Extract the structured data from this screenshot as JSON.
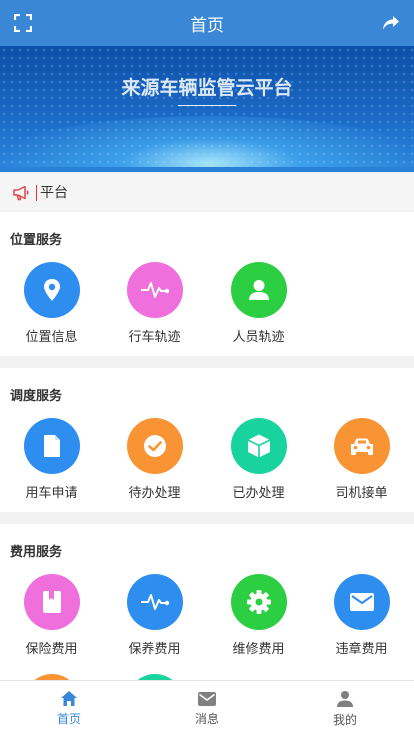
{
  "header": {
    "title": "首页"
  },
  "banner": {
    "title": "来源车辆监管云平台"
  },
  "notice": {
    "text": "平台"
  },
  "sections": [
    {
      "title": "位置服务",
      "items": [
        {
          "label": "位置信息",
          "icon": "location-pin-icon",
          "color": "#2e8ef0"
        },
        {
          "label": "行车轨迹",
          "icon": "pulse-icon",
          "color": "#ef6fdc"
        },
        {
          "label": "人员轨迹",
          "icon": "person-icon",
          "color": "#2bcf41"
        }
      ]
    },
    {
      "title": "调度服务",
      "items": [
        {
          "label": "用车申请",
          "icon": "document-icon",
          "color": "#2e8ef0"
        },
        {
          "label": "待办处理",
          "icon": "check-circle-icon",
          "color": "#f89433"
        },
        {
          "label": "已办处理",
          "icon": "cube-icon",
          "color": "#18d39e"
        },
        {
          "label": "司机接单",
          "icon": "car-icon",
          "color": "#f89433"
        }
      ]
    },
    {
      "title": "费用服务",
      "items": [
        {
          "label": "保险费用",
          "icon": "book-icon",
          "color": "#ef6fdc"
        },
        {
          "label": "保养费用",
          "icon": "pulse-icon",
          "color": "#2e8ef0"
        },
        {
          "label": "维修费用",
          "icon": "gear-icon",
          "color": "#2bcf41"
        },
        {
          "label": "违章费用",
          "icon": "mail-icon",
          "color": "#2e8ef0"
        }
      ]
    }
  ],
  "tabbar": {
    "items": [
      {
        "label": "首页",
        "icon": "home-icon",
        "active": true
      },
      {
        "label": "消息",
        "icon": "message-icon",
        "active": false
      },
      {
        "label": "我的",
        "icon": "user-icon",
        "active": false
      }
    ],
    "active_color": "#3a87d6"
  }
}
